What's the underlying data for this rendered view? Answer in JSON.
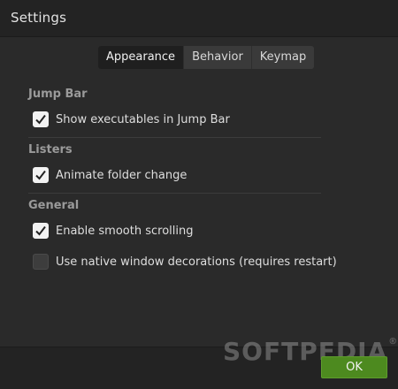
{
  "window": {
    "title": "Settings"
  },
  "tabs": [
    {
      "label": "Appearance",
      "active": true
    },
    {
      "label": "Behavior",
      "active": false
    },
    {
      "label": "Keymap",
      "active": false
    }
  ],
  "sections": {
    "jump_bar": {
      "label": "Jump Bar",
      "options": [
        {
          "label": "Show executables in Jump Bar",
          "checked": true
        }
      ]
    },
    "listers": {
      "label": "Listers",
      "options": [
        {
          "label": "Animate folder change",
          "checked": true
        }
      ]
    },
    "general": {
      "label": "General",
      "options": [
        {
          "label": "Enable smooth scrolling",
          "checked": true
        },
        {
          "label": "Use native window decorations (requires restart)",
          "checked": false
        }
      ]
    }
  },
  "footer": {
    "ok_label": "OK",
    "watermark": "SOFTPEDIA",
    "watermark_mark": "®"
  },
  "colors": {
    "background": "#2a2a2a",
    "titlebar": "#232323",
    "accent_ok": "#4d8a1f",
    "checkbox_checked": "#f2f2f2",
    "checkbox_unchecked": "#3d3d3d"
  }
}
